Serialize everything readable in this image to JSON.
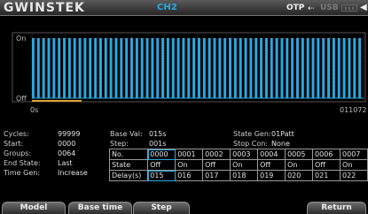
{
  "header": {
    "brand": "GWINSTEK",
    "channel": "CH2",
    "otp_label": "OTP",
    "usb_label": "USB",
    "icons": [
      "otp-arrow-icon",
      "usb-icon",
      "lan-icon",
      "speaker-icon"
    ]
  },
  "waveform": {
    "y_high_label": "On",
    "y_low_label": "Off",
    "x_start_label": "0s",
    "x_end_label": "011072",
    "trace_color": "#2aa9e0",
    "pattern": [
      1,
      0,
      1,
      0,
      1,
      0,
      1,
      0,
      1,
      0,
      1,
      0,
      1,
      0,
      1,
      0,
      1,
      0,
      1,
      0,
      1,
      0,
      1,
      0,
      1,
      0,
      1,
      0,
      1,
      0,
      1,
      0,
      1,
      0,
      1,
      0,
      1,
      0,
      1,
      0,
      1,
      0,
      1,
      0,
      1,
      0,
      1,
      0,
      1,
      0,
      1,
      0,
      1,
      0,
      1,
      0,
      1,
      0,
      1,
      0,
      1,
      0,
      1,
      0,
      1,
      0,
      1,
      0,
      1,
      0,
      1,
      0,
      1,
      0,
      1,
      0,
      1,
      0,
      1,
      0,
      1,
      0,
      1,
      0,
      1,
      0,
      1,
      0,
      1,
      0,
      1,
      0,
      1,
      0,
      1,
      0,
      1,
      0,
      1,
      0,
      1,
      0,
      1,
      0,
      1,
      0,
      1,
      0,
      1,
      0,
      1,
      0,
      1,
      0,
      1,
      0,
      1,
      0,
      1,
      0,
      1,
      0,
      1,
      0,
      1,
      0,
      1,
      0
    ]
  },
  "params": {
    "cycles_label": "Cycles:",
    "cycles_value": "99999",
    "start_label": "Start:",
    "start_value": "0000",
    "groups_label": "Groups:",
    "groups_value": "0064",
    "end_state_label": "End State:",
    "end_state_value": "Last",
    "time_gen_label": "Time Gen:",
    "time_gen_value": "Increase",
    "base_val_label": "Base Val:",
    "base_val_value": "015s",
    "step_label": "Step:",
    "step_value": "001s",
    "state_gen_label": "State Gen:",
    "state_gen_value": "01Patt",
    "stop_con_label": "Stop Con:",
    "stop_con_value": "None"
  },
  "table": {
    "row_headers": [
      "No.",
      "State",
      "Delay(s)"
    ],
    "numbers": [
      "0000",
      "0001",
      "0002",
      "0003",
      "0004",
      "0005",
      "0006",
      "0007"
    ],
    "states": [
      "Off",
      "On",
      "Off",
      "On",
      "Off",
      "On",
      "Off",
      "On"
    ],
    "delays": [
      "015",
      "016",
      "017",
      "018",
      "019",
      "020",
      "021",
      "022"
    ]
  },
  "softkeys": {
    "model": "Model",
    "base_time": "Base time",
    "step": "Step",
    "return": "Return"
  }
}
